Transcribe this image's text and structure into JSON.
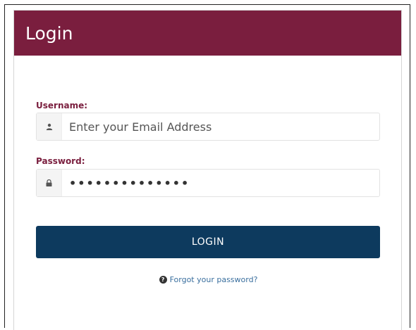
{
  "colors": {
    "header_bg": "#7a1e3e",
    "label": "#7a1e3e",
    "button_bg": "#0d3a5e",
    "link": "#3a6f9e"
  },
  "header": {
    "title": "Login"
  },
  "form": {
    "username": {
      "label": "Username:",
      "value": "",
      "placeholder": "Enter your Email Address",
      "icon": "user-icon"
    },
    "password": {
      "label": "Password:",
      "value": "••••••••••••••",
      "icon": "lock-icon"
    },
    "submit_label": "LOGIN",
    "forgot": {
      "icon": "question-circle-icon",
      "label": "Forgot your password?"
    }
  }
}
